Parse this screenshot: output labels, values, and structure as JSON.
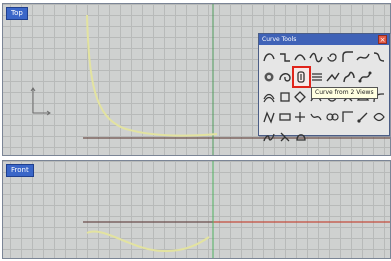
{
  "viewports": {
    "top": {
      "label": "Top"
    },
    "front": {
      "label": "Front"
    }
  },
  "toolbar": {
    "title": "Curve Tools",
    "close_glyph": "×",
    "rows": [
      [
        "curve-icon",
        "blend-icon",
        "arc-icon",
        "wave-icon",
        "spiral-icon",
        "fillet-icon",
        "curve-icon",
        "curve-icon"
      ],
      [
        "pipe-icon",
        "loop-icon",
        "curve-from-2-views-icon",
        "rebuild-icon",
        "bend-icon",
        "freeform-icon",
        "edit-points-icon"
      ],
      [
        "offset-icon",
        "shape-icon",
        "shape-icon",
        "shape-icon",
        "shape-icon",
        "shape-icon",
        "shape-icon",
        "blend-icon"
      ],
      [
        "shape-icon",
        "shape-icon",
        "shape-icon",
        "shape-icon",
        "shape-icon",
        "shape-icon",
        "shape-icon",
        "shape-icon"
      ],
      [
        "shape-icon",
        "shape-icon",
        "shape-icon"
      ]
    ],
    "active_tool": "curve-from-2-views-icon"
  },
  "tooltip": {
    "text": "Curve from 2 Views"
  },
  "colors": {
    "curve": "#e3e3a0",
    "grid": "#b8bab9",
    "axis_x": "#c44c3c",
    "axis_y": "#4fb15f",
    "highlight": "#e0241b"
  }
}
